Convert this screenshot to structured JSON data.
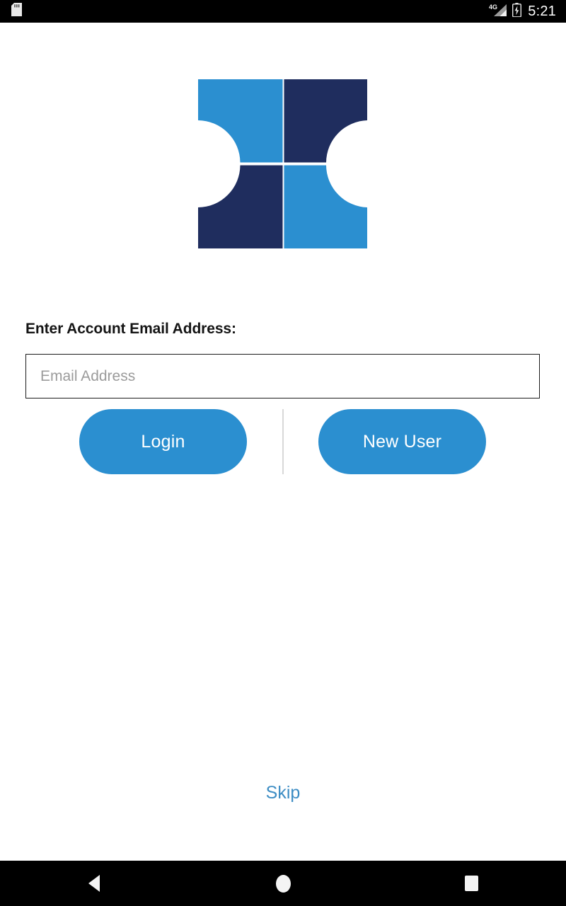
{
  "status_bar": {
    "time": "5:21",
    "left_icons": [
      {
        "name": "sd-card-icon",
        "label": "SD card"
      }
    ],
    "right_icons": [
      {
        "name": "signal-4g-icon",
        "label": "4G",
        "network": "4G"
      },
      {
        "name": "battery-charging-icon",
        "label": "Battery charging"
      }
    ]
  },
  "logo": {
    "name": "app-logo",
    "description": "Four quarter-ring butterfly mark",
    "colors": {
      "light_blue": "#2b8fd0",
      "dark_navy": "#1f2d5e"
    },
    "quadrants": [
      {
        "position": "top-left",
        "color": "#2b8fd0"
      },
      {
        "position": "top-right",
        "color": "#1f2d5e"
      },
      {
        "position": "bottom-left",
        "color": "#1f2d5e"
      },
      {
        "position": "bottom-right",
        "color": "#2b8fd0"
      }
    ]
  },
  "form": {
    "email_label": "Enter Account Email Address:",
    "email_placeholder": "Email Address",
    "email_value": ""
  },
  "actions": {
    "login_label": "Login",
    "new_user_label": "New User",
    "skip_label": "Skip"
  },
  "theme": {
    "accent_blue": "#2b8fd0",
    "link_blue": "#3d8dc4",
    "navy": "#1f2d5e",
    "background": "#ffffff",
    "bar_background": "#000000",
    "placeholder_gray": "#9b9b9b",
    "divider_gray": "#d8d8d8"
  },
  "nav_bar": {
    "buttons": [
      {
        "name": "nav-back-button",
        "label": "Back"
      },
      {
        "name": "nav-home-button",
        "label": "Home"
      },
      {
        "name": "nav-recents-button",
        "label": "Recents"
      }
    ]
  }
}
